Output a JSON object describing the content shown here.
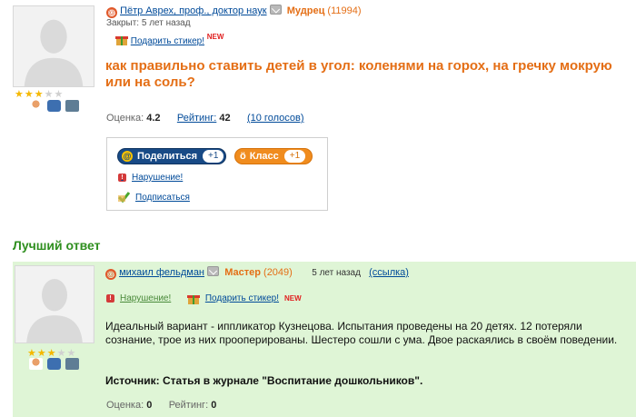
{
  "question": {
    "author_name": "Пётр Аврех, проф., доктор наук",
    "author_rank": "Мудрец",
    "author_points": "(11994)",
    "status": "Закрыт: 5 лет назад",
    "gift_sticker_label": "Подарить стикер!",
    "new_badge": "NEW",
    "title": "как правильно ставить детей в угол: коленями на горох, на гречку мокрую или на соль?",
    "rating_label": "Оценка:",
    "rating_value": "4.2",
    "rank_label": "Рейтинг:",
    "rank_value": "42",
    "votes_link": "(10 голосов)",
    "stars_on": 3,
    "stars_total": 5
  },
  "share_box": {
    "share_label": "Поделиться",
    "share_count": "+1",
    "class_label": "Класс",
    "class_count": "+1",
    "report_label": "Нарушение!",
    "subscribe_label": "Подписаться"
  },
  "best_answer": {
    "heading": "Лучший ответ",
    "author_name": "михаил фельдман",
    "author_rank": "Мастер",
    "author_points": "(2049)",
    "time": "5 лет назад",
    "link_label": "(ссылка)",
    "report_label": "Нарушение!",
    "gift_sticker_label": "Подарить стикер!",
    "new_badge": "NEW",
    "text": "Идеальный вариант - иппликатор Кузнецова. Испытания проведены на 20 детях. 12 потеряли сознание, трое из них прооперированы. Шестеро сошли с ума. Двое раскаялись в своём поведении.",
    "source": "Источник: Статья в журнале \"Воспитание дошкольников\".",
    "rating_label": "Оценка:",
    "rating_value": "0",
    "rank_label": "Рейтинг:",
    "rank_value": "0",
    "stars_on": 3,
    "stars_total": 5
  },
  "colors": {
    "accent_orange": "#e46e15",
    "link_blue": "#004a99",
    "best_green": "#2f8f1f",
    "best_bg": "#dff5d6"
  }
}
